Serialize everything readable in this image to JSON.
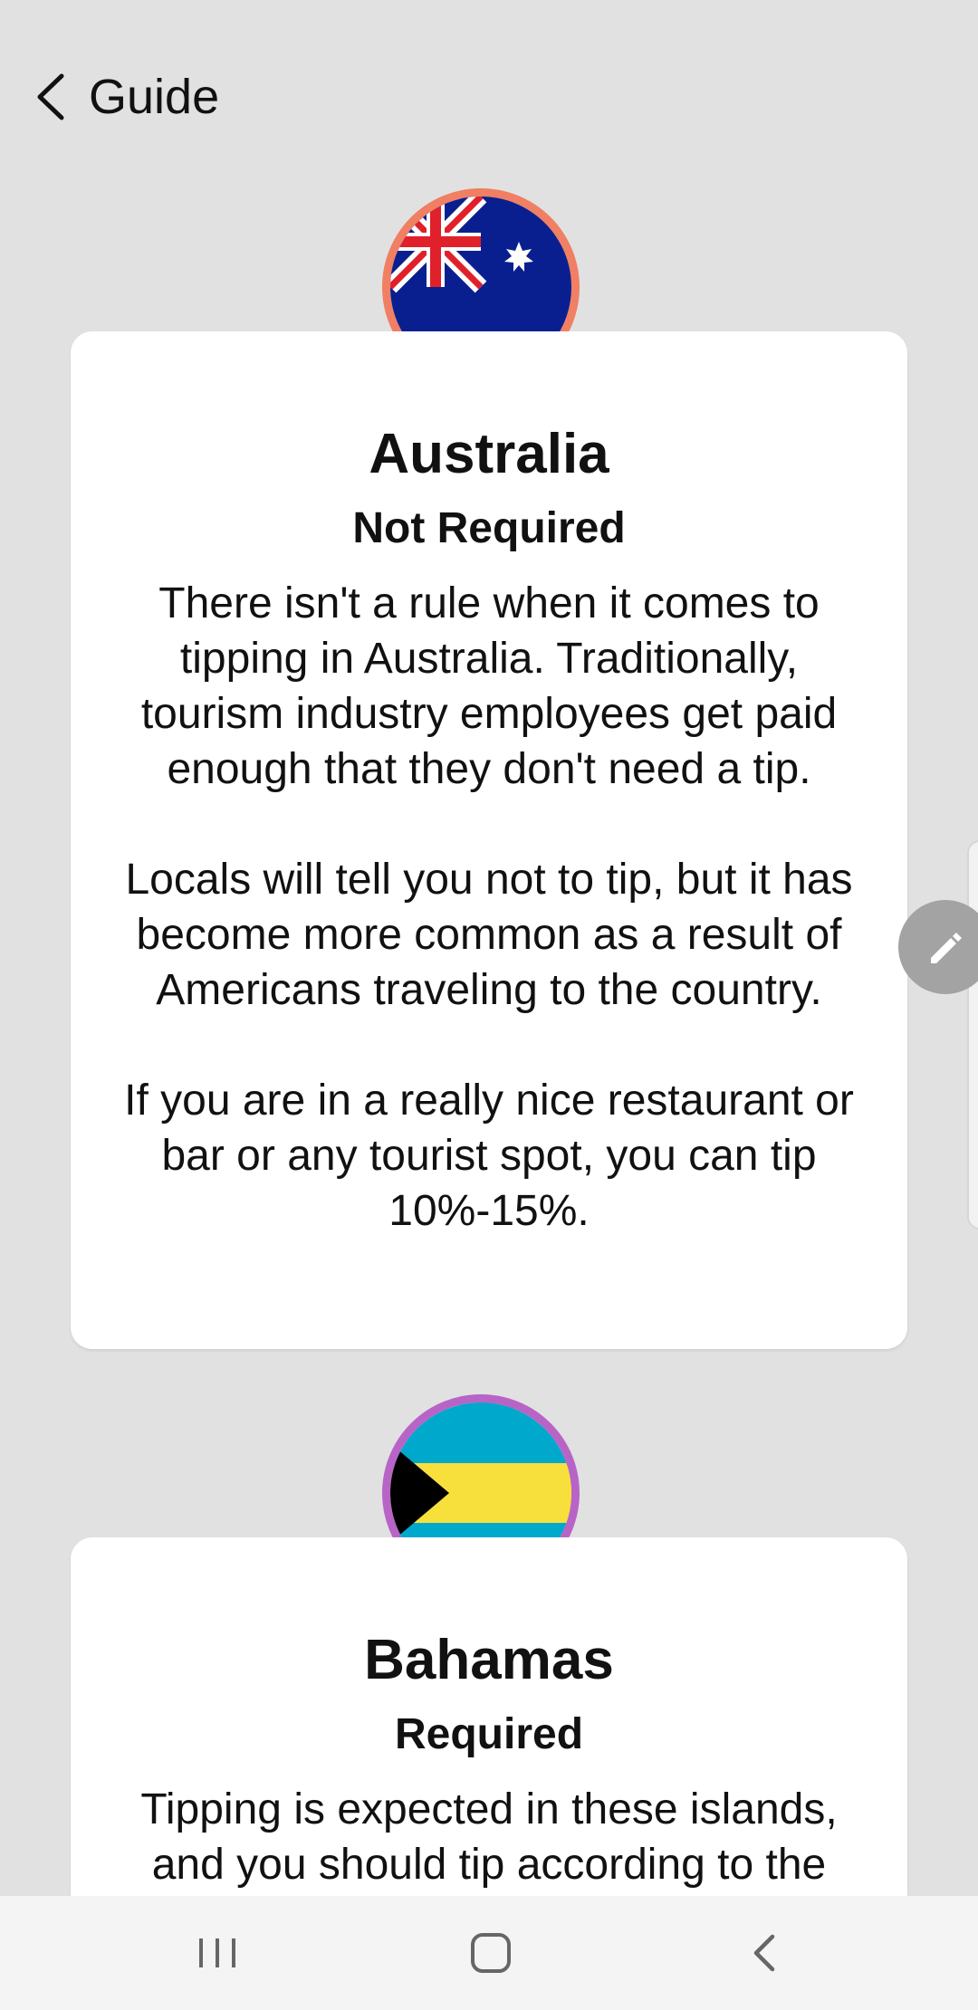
{
  "header": {
    "title": "Guide",
    "back_icon": "chevron-left-icon"
  },
  "countries": [
    {
      "name": "Australia",
      "status": "Not Required",
      "flag_icon": "australia-flag-icon",
      "ring_color": "#f07f63",
      "paragraphs": [
        "There isn't a rule when it comes to tipping in Australia. Traditionally, tourism industry employees get paid enough that they don't need a tip.",
        "Locals will tell you not to tip, but it has become more common as a result of Americans traveling to the country.",
        "If you are in a really nice restaurant or bar or any tourist spot, you can tip 10%-15%."
      ]
    },
    {
      "name": "Bahamas",
      "status": "Required",
      "flag_icon": "bahamas-flag-icon",
      "ring_color": "#b864c7",
      "paragraphs": [
        "Tipping is expected in these islands, and you should tip according to the"
      ]
    }
  ],
  "floating": {
    "edit_icon": "pencil-icon"
  },
  "navbar": {
    "recent_icon": "recent-apps-icon",
    "home_icon": "home-icon",
    "back_icon": "back-icon"
  },
  "colors": {
    "background": "#e1e1e1",
    "card": "#ffffff",
    "edit_button": "#a3a3a3"
  }
}
